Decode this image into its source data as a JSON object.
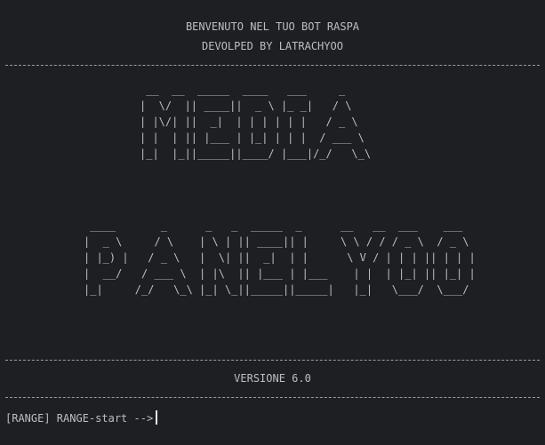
{
  "header": {
    "title": "BENVENUTO NEL TUO BOT RASPA",
    "subtitle": "DEVOLPED BY LATRACHYOO"
  },
  "banner": {
    "word1": " __  __  _____  ____   ___     _   \n|  \\/  || ____||  _ \\ |_ _|   / \\  \n| |\\/| ||  _|  | | | | | |   / _ \\ \n| |  | || |___ | |_| | | |  / ___ \\\n|_|  |_||_____||____/ |___|/_/   \\_\\",
    "word2": " ____       _      _   _  _____  _      __   __  ___    ___  \n|  _ \\     / \\    | \\ | || ____|| |     \\ \\ / / / _ \\  / _ \\ \n| |_) |   / _ \\   |  \\| ||  _|  | |      \\ V / | | | || | | |\n|  __/   / ___ \\  | |\\  || |___ | |___    | |  | |_| || |_| |\n|_|     /_/   \\_\\ |_| \\_||_____||_____|   |_|   \\___/  \\___/ "
  },
  "footer": {
    "version": "VERSIONE 6.0"
  },
  "prompt": {
    "text": "[RANGE] RANGE-start -->"
  }
}
